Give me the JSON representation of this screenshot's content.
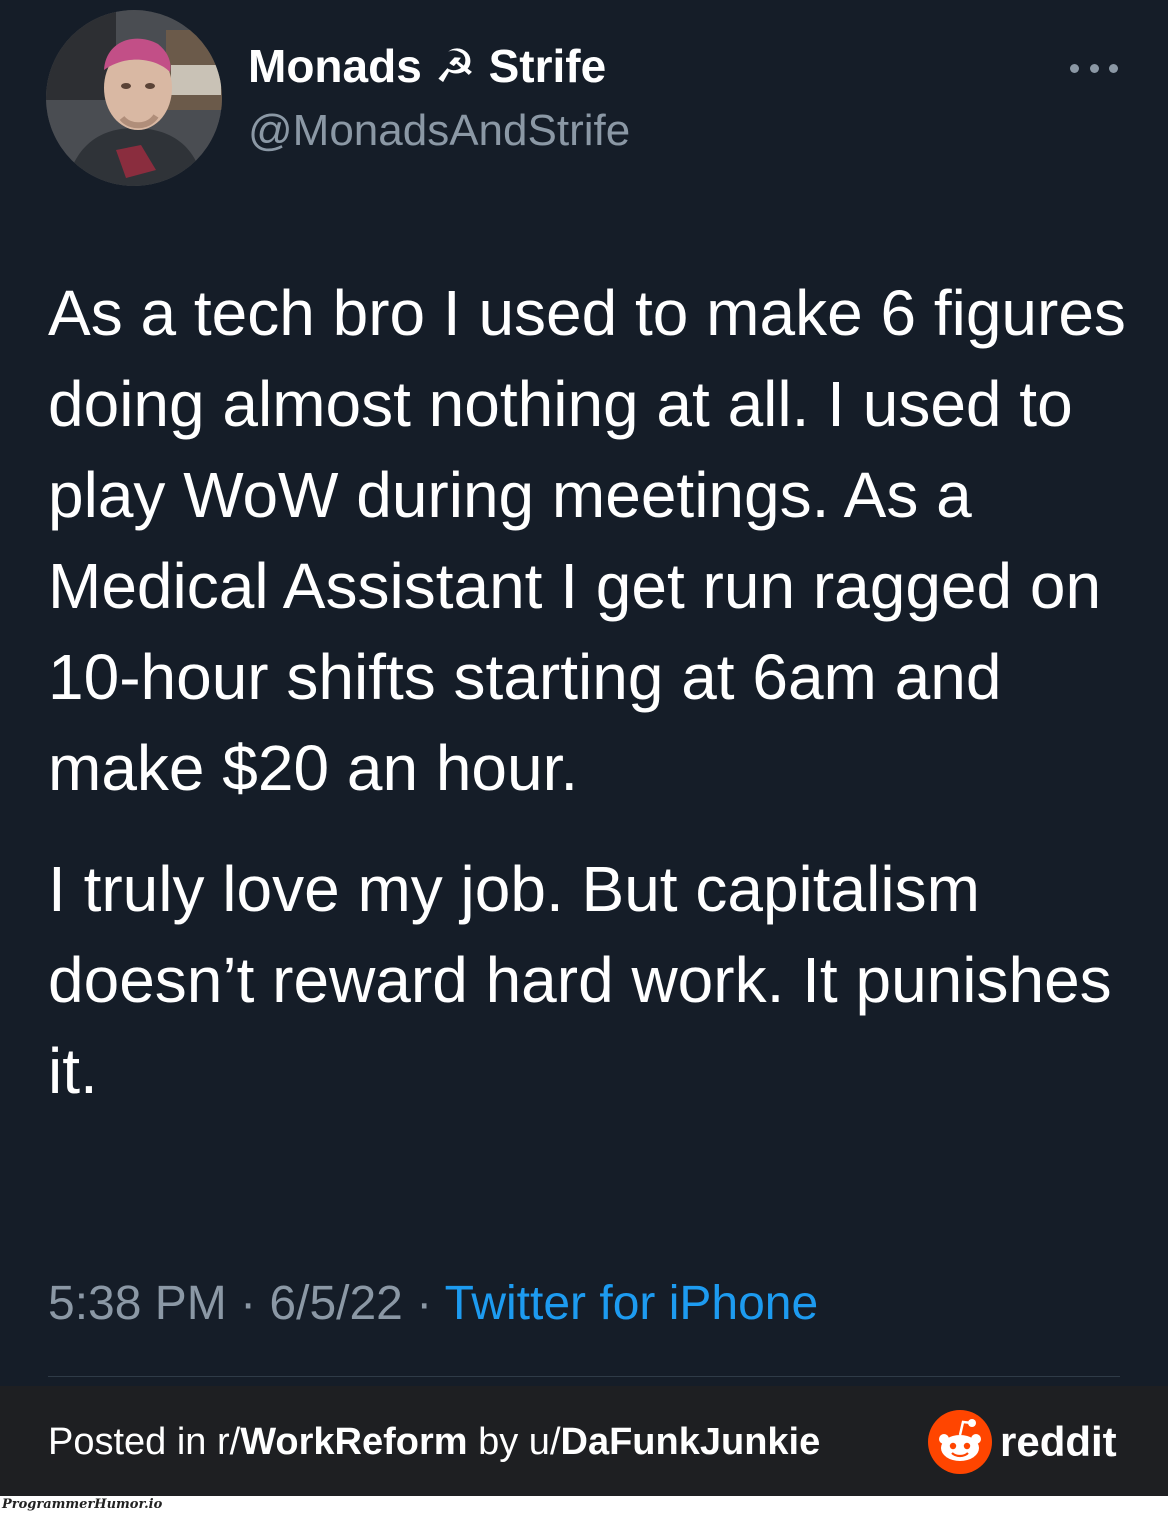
{
  "tweet": {
    "display_name": "Monads ☭ Strife",
    "handle": "@MonadsAndStrife",
    "paragraphs": [
      "As a tech bro I used to make 6 figures doing almost nothing at all. I used to play WoW during meetings. As a Medical Assistant I get run ragged on 10-hour shifts starting at 6am and make $20 an hour.",
      "I truly love my job. But capitalism doesn’t reward hard work. It punishes it."
    ],
    "time": "5:38 PM",
    "separator": " · ",
    "date": "6/5/22",
    "source": "Twitter for iPhone",
    "more_icon": "more-horizontal-icon"
  },
  "footer": {
    "posted_in_prefix": "Posted in r/",
    "subreddit": "WorkReform",
    "by_prefix": " by u/",
    "username": "DaFunkJunkie",
    "brand": "reddit",
    "brand_color": "#ff4500"
  },
  "watermark": "ProgrammerHumor.io",
  "colors": {
    "background": "#151d28",
    "text": "#ffffff",
    "muted": "#8b98a5",
    "link": "#1d9bf0",
    "footer_bg": "#1e1f22"
  }
}
